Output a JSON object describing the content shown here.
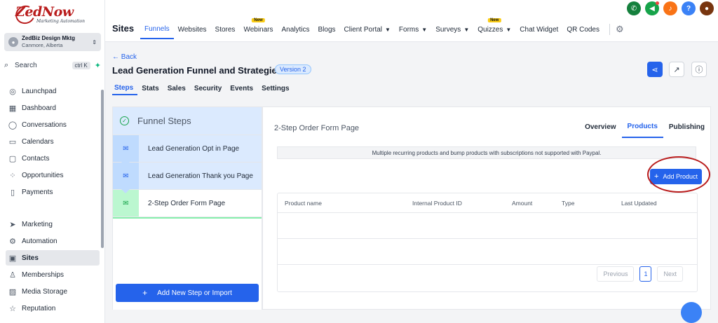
{
  "brand": {
    "logo_text": "ZedNow",
    "tagline": "Marketing Automation"
  },
  "account": {
    "name": "ZedBiz Design Mktg",
    "location": "Canmore, Alberta"
  },
  "search": {
    "label": "Search",
    "shortcut": "ctrl K"
  },
  "sidebar": {
    "items": [
      {
        "label": "Launchpad"
      },
      {
        "label": "Dashboard"
      },
      {
        "label": "Conversations"
      },
      {
        "label": "Calendars"
      },
      {
        "label": "Contacts"
      },
      {
        "label": "Opportunities"
      },
      {
        "label": "Payments"
      },
      {
        "label": "Marketing"
      },
      {
        "label": "Automation"
      },
      {
        "label": "Sites"
      },
      {
        "label": "Memberships"
      },
      {
        "label": "Media Storage"
      },
      {
        "label": "Reputation"
      }
    ],
    "active": "Sites"
  },
  "header": {
    "section": "Sites",
    "tabs": [
      {
        "label": "Funnels"
      },
      {
        "label": "Websites"
      },
      {
        "label": "Stores"
      },
      {
        "label": "Webinars",
        "badge": "New"
      },
      {
        "label": "Analytics"
      },
      {
        "label": "Blogs"
      },
      {
        "label": "Client Portal"
      },
      {
        "label": "Forms"
      },
      {
        "label": "Surveys"
      },
      {
        "label": "Quizzes",
        "badge": "New"
      },
      {
        "label": "Chat Widget"
      },
      {
        "label": "QR Codes"
      }
    ]
  },
  "page": {
    "back": "← Back",
    "title": "Lead Generation Funnel and Strategies",
    "version": "Version 2",
    "subtabs": [
      {
        "label": "Steps"
      },
      {
        "label": "Stats"
      },
      {
        "label": "Sales"
      },
      {
        "label": "Security"
      },
      {
        "label": "Events"
      },
      {
        "label": "Settings"
      }
    ]
  },
  "funnel_steps": {
    "title": "Funnel Steps",
    "steps": [
      {
        "label": "Lead Generation Opt in Page"
      },
      {
        "label": "Lead Generation Thank you Page"
      },
      {
        "label": "2-Step Order Form Page"
      }
    ],
    "add_label": "Add New Step or Import"
  },
  "step_detail": {
    "title": "2-Step Order Form Page",
    "tabs": [
      {
        "label": "Overview"
      },
      {
        "label": "Products"
      },
      {
        "label": "Publishing"
      }
    ],
    "notice": "Multiple recurring products and bump products with subscriptions not supported with Paypal.",
    "add_product": "Add Product",
    "columns": [
      "Product name",
      "Internal Product ID",
      "Amount",
      "Type",
      "Last Updated"
    ],
    "pager": {
      "prev": "Previous",
      "page": "1",
      "next": "Next"
    }
  },
  "colors": {
    "accent": "#2563eb",
    "highlight_ring": "#b91c1c"
  }
}
